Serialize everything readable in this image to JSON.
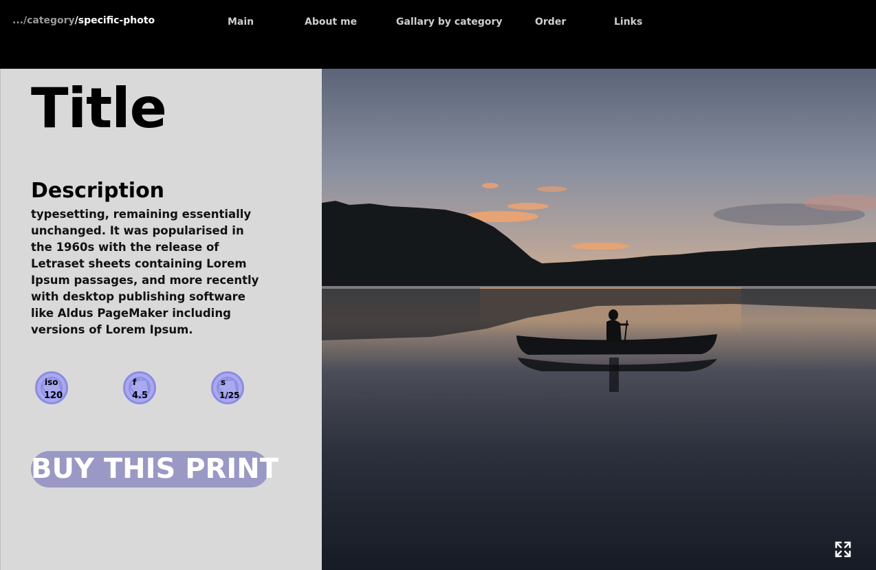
{
  "breadcrumb": {
    "dim": ".../category",
    "current": "/specific-photo"
  },
  "nav": {
    "items": [
      {
        "label": "Main"
      },
      {
        "label": "About me"
      },
      {
        "label": "Gallary by category"
      },
      {
        "label": "Order"
      },
      {
        "label": "Links"
      }
    ]
  },
  "photo_detail": {
    "title": "Title",
    "description_heading": "Description",
    "description_text": "typesetting, remaining essentially unchanged. It was popularised in the 1960s with the release of Letraset sheets containing Lorem Ipsum passages, and more recently with desktop publishing software like Aldus PageMaker including versions of Lorem Ipsum.",
    "stats": [
      {
        "label": "iso",
        "value": "120",
        "icon": "aperture-icon"
      },
      {
        "label": "f",
        "value": "4.5",
        "icon": "aperture-icon"
      },
      {
        "label": "s",
        "value": "1/25",
        "icon": "aperture-icon"
      }
    ],
    "buy_label": "BUY THIS PRINT"
  },
  "photo": {
    "icon": "expand-icon"
  },
  "colors": {
    "panel_bg": "#d9d9d9",
    "accent": "#9a98c4",
    "stat_circle": "#a9a9ef",
    "topbar_bg": "#000000"
  }
}
